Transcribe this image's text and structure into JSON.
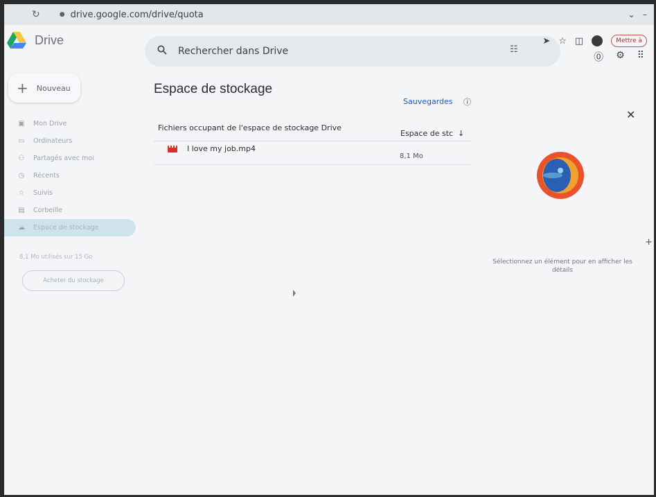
{
  "browser": {
    "url": "drive.google.com/drive/quota"
  },
  "header": {
    "app_name": "Drive",
    "search_placeholder": "Rechercher dans Drive",
    "mettre_label": "Mettre à"
  },
  "sidebar": {
    "new_label": "Nouveau",
    "items": [
      {
        "label": "Mon Drive",
        "icon": "drive-icon"
      },
      {
        "label": "Ordinateurs",
        "icon": "computer-icon"
      },
      {
        "label": "Partagés avec moi",
        "icon": "people-icon"
      },
      {
        "label": "Récents",
        "icon": "clock-icon"
      },
      {
        "label": "Suivis",
        "icon": "star-icon"
      },
      {
        "label": "Corbeille",
        "icon": "trash-icon"
      },
      {
        "label": "Espace de stockage",
        "icon": "cloud-icon"
      }
    ],
    "quota_text": "8,1 Mo utilisés sur 15 Go",
    "buy_label": "Acheter du stockage"
  },
  "main": {
    "title": "Espace de stockage",
    "backups_label": "Sauvegardes",
    "col_files": "Fichiers occupant de l'espace de stockage Drive",
    "col_space": "Espace de stc",
    "files": [
      {
        "name": "I love my job.mp4",
        "size": "8,1 Mo"
      }
    ]
  },
  "details": {
    "empty_text": "Sélectionnez un élément pour en afficher les détails"
  },
  "colors": {
    "accent": "#1a56b8",
    "active_nav": "#cfe3ef",
    "video_icon": "#d93025"
  }
}
